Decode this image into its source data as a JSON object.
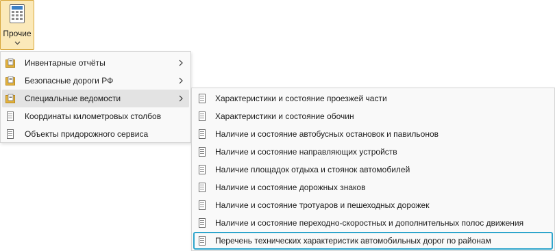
{
  "ribbon": {
    "button_label": "Прочие",
    "icon": "calculator-document-icon",
    "dropdown_icon": "chevron-down-icon"
  },
  "main_menu": {
    "items": [
      {
        "label": "Инвентарные отчёты",
        "icon": "folder-doc-icon",
        "has_submenu": true
      },
      {
        "label": "Безопасные дороги РФ",
        "icon": "folder-doc-icon",
        "has_submenu": true
      },
      {
        "label": "Специальные ведомости",
        "icon": "folder-doc-icon",
        "has_submenu": true,
        "state": "open"
      },
      {
        "label": "Координаты километровых столбов",
        "icon": "document-icon",
        "has_submenu": false
      },
      {
        "label": "Объекты придорожного сервиса",
        "icon": "document-icon",
        "has_submenu": false
      }
    ]
  },
  "sub_menu": {
    "items": [
      {
        "label": "Характеристики и состояние проезжей части"
      },
      {
        "label": "Характеристики и состояние обочин"
      },
      {
        "label": "Наличие и состояние автобусных остановок и павильонов"
      },
      {
        "label": "Наличие и состояние направляющих устройств"
      },
      {
        "label": "Наличие площадок отдыха и стоянок автомобилей"
      },
      {
        "label": "Наличие и состояние дорожных знаков"
      },
      {
        "label": "Наличие и состояние тротуаров и пешеходных дорожек"
      },
      {
        "label": "Наличие и состояние переходно-скоростных и дополнительных полос движения"
      },
      {
        "label": "Перечень технических характеристик автомобильных дорог по районам",
        "state": "selected"
      }
    ]
  },
  "colors": {
    "ribbon_active_bg": "#fbe9b9",
    "ribbon_active_border": "#d7a63a",
    "menu_bg": "#f9f9f9",
    "hover_bg": "#e3e3e3",
    "focus_border": "#2ea5cc",
    "folder_icon": "#e2b13c"
  }
}
